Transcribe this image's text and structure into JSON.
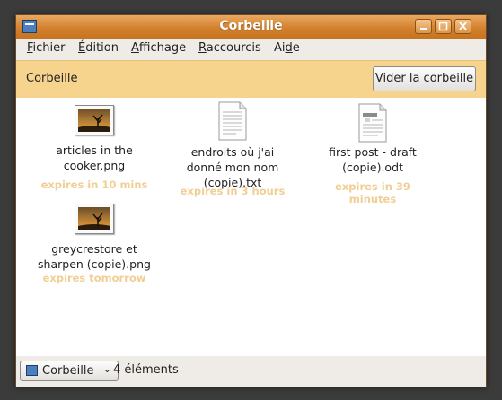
{
  "window": {
    "title": "Corbeille"
  },
  "menu": [
    {
      "pre": "",
      "ul": "F",
      "post": "ichier"
    },
    {
      "pre": "",
      "ul": "É",
      "post": "dition"
    },
    {
      "pre": "",
      "ul": "A",
      "post": "ffichage"
    },
    {
      "pre": "",
      "ul": "R",
      "post": "accourcis"
    },
    {
      "pre": "Ai",
      "ul": "d",
      "post": "e"
    }
  ],
  "location": {
    "label": "Corbeille",
    "empty_button_ul": "V",
    "empty_button_rest": "ider la corbeille"
  },
  "files": [
    {
      "line1": "articles in the",
      "line2": "cooker.png",
      "line3": "",
      "expires": "expires in 10 mins",
      "icon": "image-file-icon"
    },
    {
      "line1": "endroits où j'ai",
      "line2": "donné mon nom",
      "line3": "(copie).txt",
      "expires": "expires in 3 hours",
      "icon": "text-file-icon"
    },
    {
      "line1": "first post - draft",
      "line2": "(copie).odt",
      "line3": "",
      "expires": "expires in 39 minutes",
      "icon": "document-file-icon"
    },
    {
      "line1": "greycrestore et",
      "line2": "sharpen (copie).png",
      "line3": "",
      "expires": "expires tomorrow",
      "icon": "image-file-icon"
    }
  ],
  "status": {
    "pane_label": "Corbeille",
    "count_text": "4 éléments"
  }
}
